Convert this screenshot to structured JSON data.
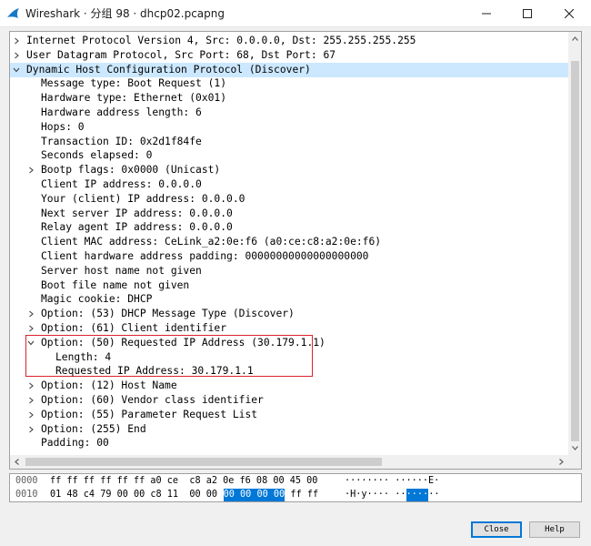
{
  "window": {
    "title": "Wireshark · 分组 98 · dhcp02.pcapng",
    "app_icon": "wireshark-fin-icon",
    "controls": [
      "minimize-icon",
      "maximize-icon",
      "close-icon"
    ]
  },
  "tree": {
    "rows": [
      {
        "text": "Internet Protocol Version 4, Src: 0.0.0.0, Dst: 255.255.255.255",
        "indent": 0,
        "arrow": "collapsed"
      },
      {
        "text": "User Datagram Protocol, Src Port: 68, Dst Port: 67",
        "indent": 0,
        "arrow": "collapsed"
      },
      {
        "text": "Dynamic Host Configuration Protocol (Discover)",
        "indent": 0,
        "arrow": "expanded",
        "selected": true
      },
      {
        "text": "Message type: Boot Request (1)",
        "indent": 1,
        "arrow": "none"
      },
      {
        "text": "Hardware type: Ethernet (0x01)",
        "indent": 1,
        "arrow": "none"
      },
      {
        "text": "Hardware address length: 6",
        "indent": 1,
        "arrow": "none"
      },
      {
        "text": "Hops: 0",
        "indent": 1,
        "arrow": "none"
      },
      {
        "text": "Transaction ID: 0x2d1f84fe",
        "indent": 1,
        "arrow": "none"
      },
      {
        "text": "Seconds elapsed: 0",
        "indent": 1,
        "arrow": "none"
      },
      {
        "text": "Bootp flags: 0x0000 (Unicast)",
        "indent": 1,
        "arrow": "collapsed"
      },
      {
        "text": "Client IP address: 0.0.0.0",
        "indent": 1,
        "arrow": "none"
      },
      {
        "text": "Your (client) IP address: 0.0.0.0",
        "indent": 1,
        "arrow": "none"
      },
      {
        "text": "Next server IP address: 0.0.0.0",
        "indent": 1,
        "arrow": "none"
      },
      {
        "text": "Relay agent IP address: 0.0.0.0",
        "indent": 1,
        "arrow": "none"
      },
      {
        "text": "Client MAC address: CeLink_a2:0e:f6 (a0:ce:c8:a2:0e:f6)",
        "indent": 1,
        "arrow": "none"
      },
      {
        "text": "Client hardware address padding: 00000000000000000000",
        "indent": 1,
        "arrow": "none"
      },
      {
        "text": "Server host name not given",
        "indent": 1,
        "arrow": "none"
      },
      {
        "text": "Boot file name not given",
        "indent": 1,
        "arrow": "none"
      },
      {
        "text": "Magic cookie: DHCP",
        "indent": 1,
        "arrow": "none"
      },
      {
        "text": "Option: (53) DHCP Message Type (Discover)",
        "indent": 1,
        "arrow": "collapsed"
      },
      {
        "text": "Option: (61) Client identifier",
        "indent": 1,
        "arrow": "collapsed"
      },
      {
        "text": "Option: (50) Requested IP Address (30.179.1.1)",
        "indent": 1,
        "arrow": "expanded"
      },
      {
        "text": "Length: 4",
        "indent": 2,
        "arrow": "none"
      },
      {
        "text": "Requested IP Address: 30.179.1.1",
        "indent": 2,
        "arrow": "none"
      },
      {
        "text": "Option: (12) Host Name",
        "indent": 1,
        "arrow": "collapsed"
      },
      {
        "text": "Option: (60) Vendor class identifier",
        "indent": 1,
        "arrow": "collapsed"
      },
      {
        "text": "Option: (55) Parameter Request List",
        "indent": 1,
        "arrow": "collapsed"
      },
      {
        "text": "Option: (255) End",
        "indent": 1,
        "arrow": "collapsed"
      },
      {
        "text": "Padding: 00",
        "indent": 1,
        "arrow": "none"
      }
    ]
  },
  "hex": {
    "rows": [
      {
        "offset": "0000",
        "bytes_before": "ff ff ff ff ff ff a0 ce  c8 a2 0e f6 08 00 45 00",
        "bytes_sel": "",
        "bytes_after": "",
        "ascii_before": "········ ······E·",
        "ascii_sel": "",
        "ascii_after": ""
      },
      {
        "offset": "0010",
        "bytes_before": "01 48 c4 79 00 00 c8 11  00 00 ",
        "bytes_sel": "00 00 00 00",
        "bytes_after": " ff ff",
        "ascii_before": "·H·y···· ··",
        "ascii_sel": "····",
        "ascii_after": "··"
      }
    ]
  },
  "buttons": {
    "close_label": "Close",
    "help_label": "Help"
  },
  "colors": {
    "highlight_box": "#d9232e",
    "selection_bg": "#cce8ff",
    "hex_selection": "#0078d7"
  }
}
